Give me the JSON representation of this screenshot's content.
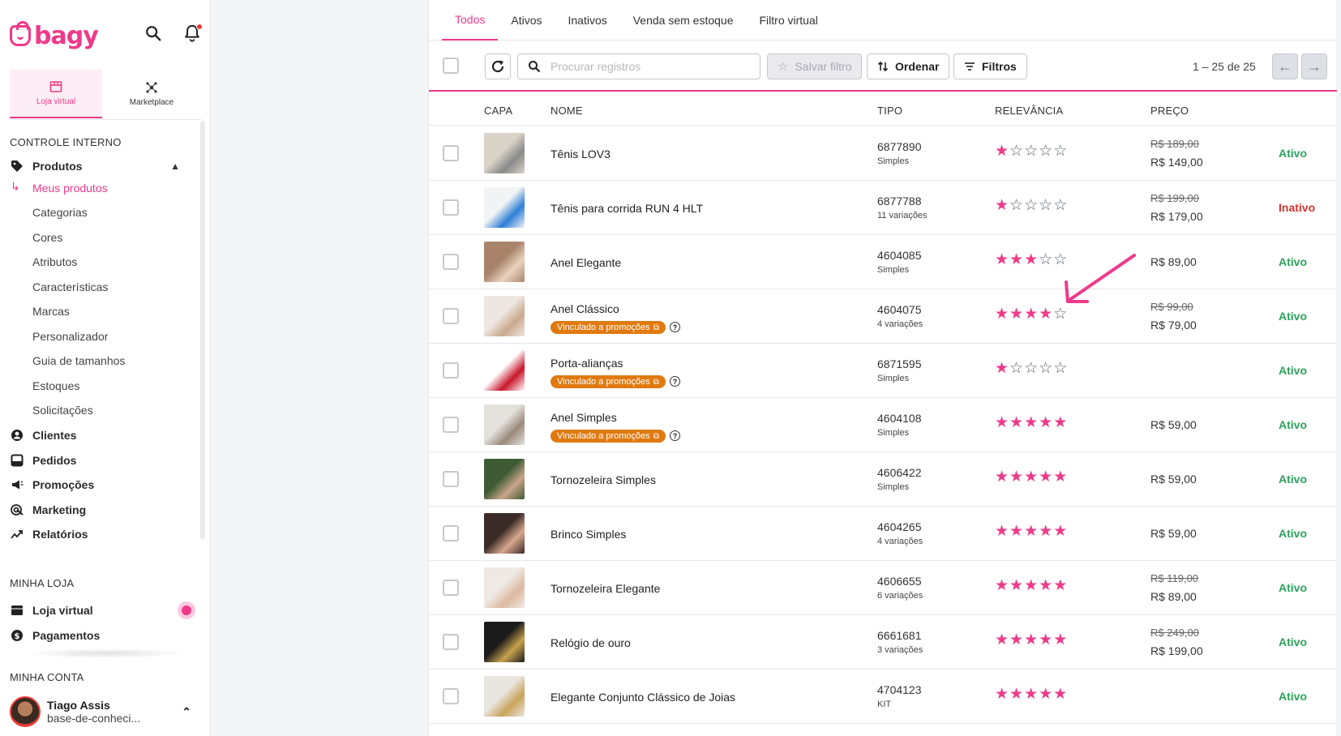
{
  "brand": {
    "logo": "bagy",
    "accent": "#ee3a8a"
  },
  "sidebar": {
    "store_tabs": [
      {
        "label": "Loja virtual",
        "icon": "store-icon",
        "active": true
      },
      {
        "label": "Marketplace",
        "icon": "marketplace-icon",
        "active": false
      }
    ],
    "section_internal": "CONTROLE INTERNO",
    "products": {
      "label": "Produtos",
      "icon": "tag-icon"
    },
    "sub_items": [
      "Meus produtos",
      "Categorias",
      "Cores",
      "Atributos",
      "Características",
      "Marcas",
      "Personalizador",
      "Guia de tamanhos",
      "Estoques",
      "Solicitações"
    ],
    "main_items": [
      {
        "label": "Clientes",
        "icon": "user-circle-icon"
      },
      {
        "label": "Pedidos",
        "icon": "inbox-icon"
      },
      {
        "label": "Promoções",
        "icon": "megaphone-icon"
      },
      {
        "label": "Marketing",
        "icon": "target-icon"
      },
      {
        "label": "Relatórios",
        "icon": "trend-icon"
      }
    ],
    "section_store": "MINHA LOJA",
    "store_items": [
      {
        "label": "Loja virtual",
        "icon": "store-icon"
      },
      {
        "label": "Pagamentos",
        "icon": "dollar-icon"
      }
    ],
    "section_account": "MINHA CONTA",
    "user": {
      "name": "Tiago Assis",
      "subtitle": "base-de-conheci..."
    }
  },
  "tabs": [
    "Todos",
    "Ativos",
    "Inativos",
    "Venda sem estoque",
    "Filtro virtual"
  ],
  "toolbar": {
    "search_placeholder": "Procurar registros",
    "save_filter": "Salvar filtro",
    "sort": "Ordenar",
    "filters": "Filtros",
    "pager": "1 – 25 de 25"
  },
  "columns": [
    "CAPA",
    "NOME",
    "TIPO",
    "RELEVÂNCIA",
    "PREÇO"
  ],
  "promo_label": "Vinculado a promoções",
  "products": [
    {
      "name": "Tênis LOV3",
      "code": "6877890",
      "type": "Simples",
      "stars": 1,
      "old_price": "R$ 189,00",
      "price": "R$ 149,00",
      "status": "Ativo",
      "promo": false,
      "thumb": [
        "#d9d2c7",
        "#8a8a8a"
      ]
    },
    {
      "name": "Tênis para corrida RUN 4 HLT",
      "code": "6877788",
      "type": "11 variações",
      "stars": 1,
      "old_price": "R$ 199,00",
      "price": "R$ 179,00",
      "status": "Inativo",
      "promo": false,
      "thumb": [
        "#f2f3f5",
        "#2e7fd6"
      ]
    },
    {
      "name": "Anel Elegante",
      "code": "4604085",
      "type": "Simples",
      "stars": 3,
      "old_price": "",
      "price": "R$ 89,00",
      "status": "Ativo",
      "promo": false,
      "thumb": [
        "#a9846b",
        "#e8d3bf"
      ]
    },
    {
      "name": "Anel Clássico",
      "code": "4604075",
      "type": "4 variações",
      "stars": 4,
      "old_price": "R$ 99,00",
      "price": "R$ 79,00",
      "status": "Ativo",
      "promo": true,
      "thumb": [
        "#eee7e1",
        "#caa98e"
      ]
    },
    {
      "name": "Porta-alianças",
      "code": "6871595",
      "type": "Simples",
      "stars": 1,
      "old_price": "",
      "price": "",
      "status": "Ativo",
      "promo": true,
      "thumb": [
        "#ffffff",
        "#c9162b"
      ]
    },
    {
      "name": "Anel Simples",
      "code": "4604108",
      "type": "Simples",
      "stars": 5,
      "old_price": "",
      "price": "R$ 59,00",
      "status": "Ativo",
      "promo": true,
      "thumb": [
        "#e4e1dd",
        "#9a8a7a"
      ]
    },
    {
      "name": "Tornozeleira Simples",
      "code": "4606422",
      "type": "Simples",
      "stars": 5,
      "old_price": "",
      "price": "R$ 59,00",
      "status": "Ativo",
      "promo": false,
      "thumb": [
        "#3f5b35",
        "#c9a58b"
      ]
    },
    {
      "name": "Brinco Simples",
      "code": "4604265",
      "type": "4 variações",
      "stars": 5,
      "old_price": "",
      "price": "R$ 59,00",
      "status": "Ativo",
      "promo": false,
      "thumb": [
        "#3b2b27",
        "#d8a78d"
      ]
    },
    {
      "name": "Tornozeleira Elegante",
      "code": "4606655",
      "type": "6 variações",
      "stars": 5,
      "old_price": "R$ 119,00",
      "price": "R$ 89,00",
      "status": "Ativo",
      "promo": false,
      "thumb": [
        "#efe9e3",
        "#dcb9a0"
      ]
    },
    {
      "name": "Relógio de ouro",
      "code": "6661681",
      "type": "3 variações",
      "stars": 5,
      "old_price": "R$ 249,00",
      "price": "R$ 199,00",
      "status": "Ativo",
      "promo": false,
      "thumb": [
        "#1b1b1b",
        "#c8a24f"
      ]
    },
    {
      "name": "Elegante Conjunto Clássico de Joias",
      "code": "4704123",
      "type": "KIT",
      "stars": 5,
      "old_price": "",
      "price": "",
      "status": "Ativo",
      "promo": false,
      "thumb": [
        "#e9e6e0",
        "#c9a35a"
      ]
    }
  ]
}
